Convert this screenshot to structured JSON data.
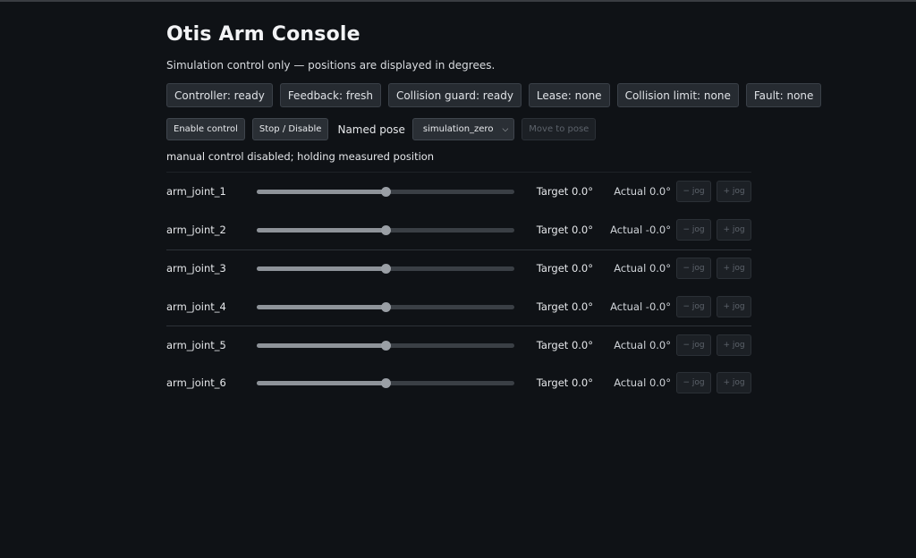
{
  "title": "Otis Arm Console",
  "subtitle": "Simulation control only — positions are displayed in degrees.",
  "status_pills": [
    "Controller: ready",
    "Feedback: fresh",
    "Collision guard: ready",
    "Lease: none",
    "Collision limit: none",
    "Fault: none"
  ],
  "controls": {
    "enable_label": "Enable control",
    "stop_label": "Stop / Disable",
    "pose_label": "Named pose",
    "pose_selected": "simulation_zero",
    "move_label": "Move to pose"
  },
  "message": "manual control disabled; holding measured position",
  "joints": [
    {
      "name": "arm_joint_1",
      "target": "Target 0.0°",
      "actual": "Actual 0.0°",
      "minus": "− jog",
      "plus": "+ jog",
      "slider_fraction": 0.5
    },
    {
      "name": "arm_joint_2",
      "target": "Target 0.0°",
      "actual": "Actual -0.0°",
      "minus": "− jog",
      "plus": "+ jog",
      "slider_fraction": 0.5
    },
    {
      "name": "arm_joint_3",
      "target": "Target 0.0°",
      "actual": "Actual 0.0°",
      "minus": "− jog",
      "plus": "+ jog",
      "slider_fraction": 0.5
    },
    {
      "name": "arm_joint_4",
      "target": "Target 0.0°",
      "actual": "Actual -0.0°",
      "minus": "− jog",
      "plus": "+ jog",
      "slider_fraction": 0.5
    },
    {
      "name": "arm_joint_5",
      "target": "Target 0.0°",
      "actual": "Actual 0.0°",
      "minus": "− jog",
      "plus": "+ jog",
      "slider_fraction": 0.5
    },
    {
      "name": "arm_joint_6",
      "target": "Target 0.0°",
      "actual": "Actual 0.0°",
      "minus": "− jog",
      "plus": "+ jog",
      "slider_fraction": 0.5
    }
  ],
  "colors": {
    "background": "#0f1216",
    "pill_bg": "#262b31",
    "slider_thumb": "#9a9fa5"
  }
}
